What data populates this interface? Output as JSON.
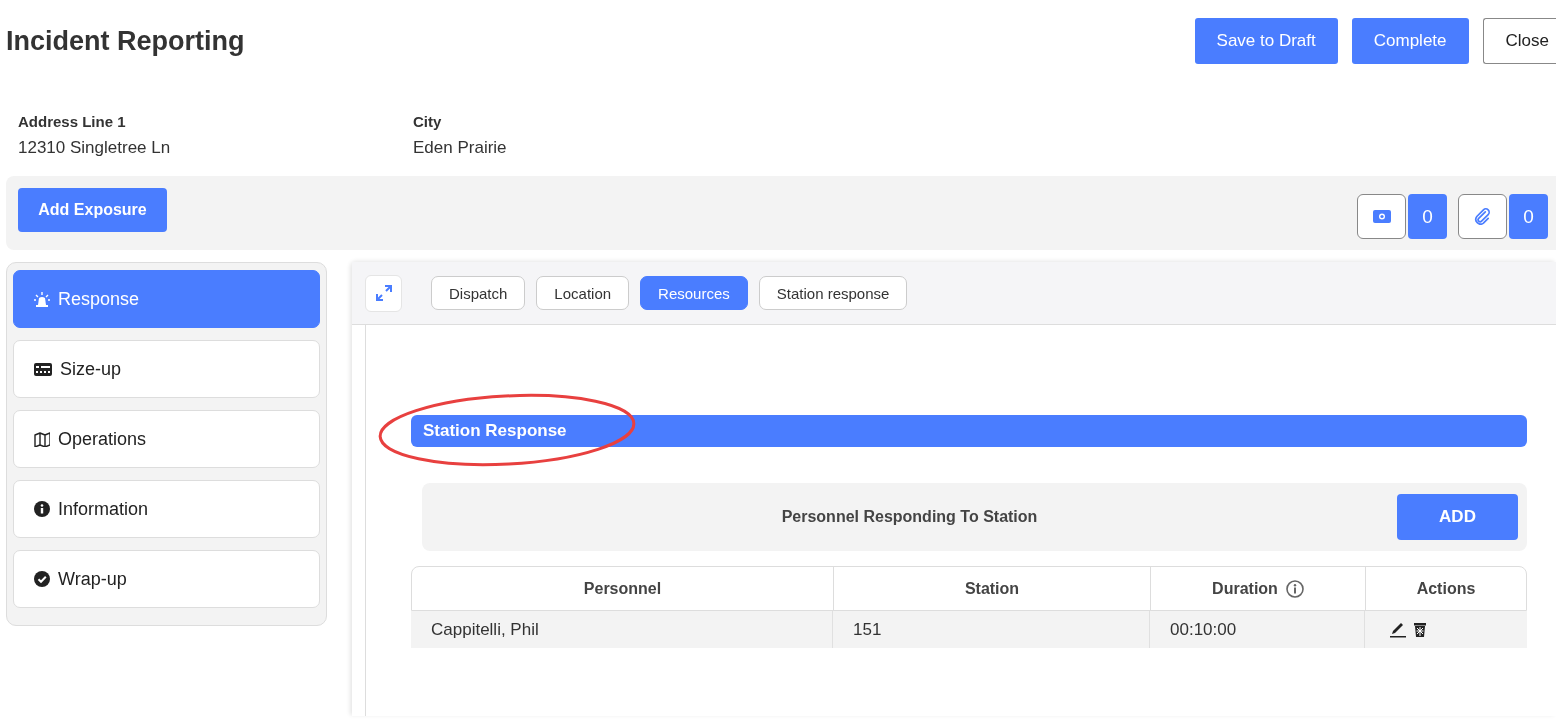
{
  "header": {
    "title": "Incident Reporting",
    "buttons": [
      {
        "label": "Save to Draft",
        "kind": "primary"
      },
      {
        "label": "Complete",
        "kind": "primary"
      },
      {
        "label": "Close",
        "kind": "outline"
      }
    ]
  },
  "address": [
    {
      "label": "Address Line 1",
      "value": "12310 Singletree Ln"
    },
    {
      "label": "City",
      "value": "Eden Prairie"
    }
  ],
  "toolbar": {
    "add_button": "Add Exposure",
    "counters": [
      {
        "kind": "photo",
        "count": "0"
      },
      {
        "kind": "attachment",
        "count": "0"
      }
    ]
  },
  "sidebar": {
    "items": [
      {
        "label": "Response",
        "kind": "siren",
        "selected": true
      },
      {
        "label": "Size-up",
        "kind": "panel",
        "selected": false
      },
      {
        "label": "Operations",
        "kind": "map",
        "selected": false
      },
      {
        "label": "Information",
        "kind": "info",
        "selected": false
      },
      {
        "label": "Wrap-up",
        "kind": "check",
        "selected": false
      }
    ]
  },
  "tabs": [
    {
      "label": "Dispatch",
      "selected": false
    },
    {
      "label": "Location",
      "selected": false
    },
    {
      "label": "Resources",
      "selected": true
    },
    {
      "label": "Station response",
      "selected": false
    }
  ],
  "section": {
    "title": "Station Response",
    "circled": true
  },
  "personnel": {
    "title": "Personnel Responding To Station",
    "add_button": "ADD"
  },
  "table": {
    "columns": [
      {
        "label": "Personnel",
        "info": false
      },
      {
        "label": "Station",
        "info": false
      },
      {
        "label": "Duration",
        "info": true
      },
      {
        "label": "Actions",
        "info": false
      }
    ],
    "rows": [
      {
        "cells": [
          "Cappitelli, Phil",
          "151",
          "00:10:00"
        ]
      }
    ]
  }
}
